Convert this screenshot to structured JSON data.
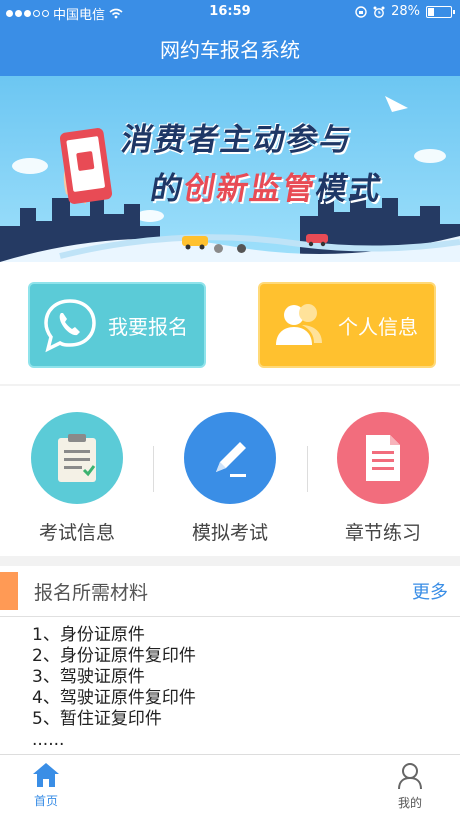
{
  "statusbar": {
    "carrier": "中国电信",
    "time": "16:59",
    "battery": "28%",
    "battery_level": 0.28
  },
  "titlebar": {
    "title": "网约车报名系统"
  },
  "banner": {
    "line1": "消费者主动参与",
    "line2_pre": "的",
    "line2_highlight": "创新监管",
    "line2_post": "模式",
    "page_indicator": {
      "count": 2,
      "active": 1
    }
  },
  "quick_actions": {
    "signup_label": "我要报名",
    "profile_label": "个人信息"
  },
  "features": [
    {
      "label": "考试信息",
      "color": "#5bcbd7",
      "icon": "clipboard-icon"
    },
    {
      "label": "模拟考试",
      "color": "#3a8ee6",
      "icon": "pencil-icon"
    },
    {
      "label": "章节练习",
      "color": "#f26d7d",
      "icon": "document-icon"
    }
  ],
  "materials": {
    "title": "报名所需材料",
    "more": "更多",
    "items": [
      "1、身份证原件",
      "2、身份证原件复印件",
      "3、驾驶证原件",
      "4、驾驶证原件复印件",
      "5、暂住证复印件",
      "......"
    ]
  },
  "tabbar": {
    "home_label": "首页",
    "mine_label": "我的"
  },
  "colors": {
    "primary": "#3a8ee6",
    "accent_orange": "#ff9a55"
  }
}
